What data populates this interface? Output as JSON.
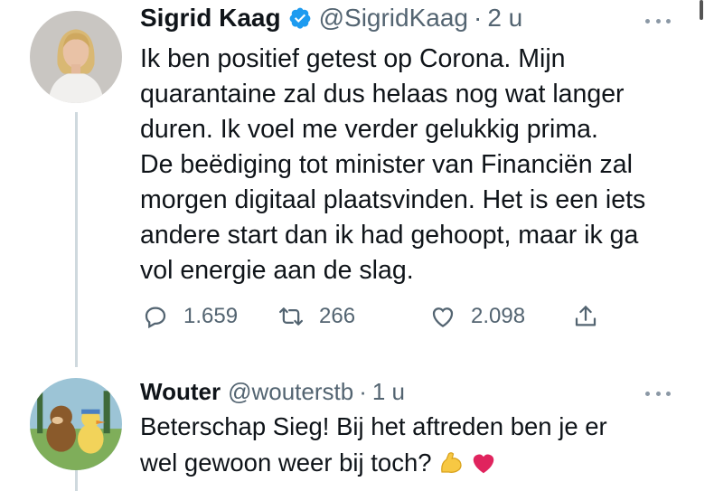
{
  "tweets": [
    {
      "author_name": "Sigrid Kaag",
      "verified": true,
      "handle": "@SigridKaag",
      "separator": "·",
      "time": "2 u",
      "text": "Ik ben positief getest op Corona. Mijn\nquarantaine zal dus helaas nog wat langer\nduren. Ik voel me verder gelukkig prima.\nDe beëdiging tot minister van Financiën zal\nmorgen digitaal plaatsvinden. Het is een iets\nandere start dan ik had gehoopt, maar ik ga\nvol energie aan de slag.",
      "replies": "1.659",
      "retweets": "266",
      "likes": "2.098"
    },
    {
      "author_name": "Wouter",
      "verified": false,
      "handle": "@wouterstb",
      "separator": "·",
      "time": "1 u",
      "text": "Beterschap Sieg! Bij het aftreden ben je er\nwel gewoon weer bij toch?",
      "emojis": [
        "flexed-biceps-emoji",
        "red-heart-emoji"
      ]
    }
  ],
  "colors": {
    "text": "#0f1419",
    "secondary": "#536471",
    "verified": "#1d9bf0",
    "thread_line": "#cfd9de"
  },
  "icons": [
    "reply-icon",
    "retweet-icon",
    "like-icon",
    "share-icon",
    "verified-badge-icon",
    "more-options-icon"
  ]
}
